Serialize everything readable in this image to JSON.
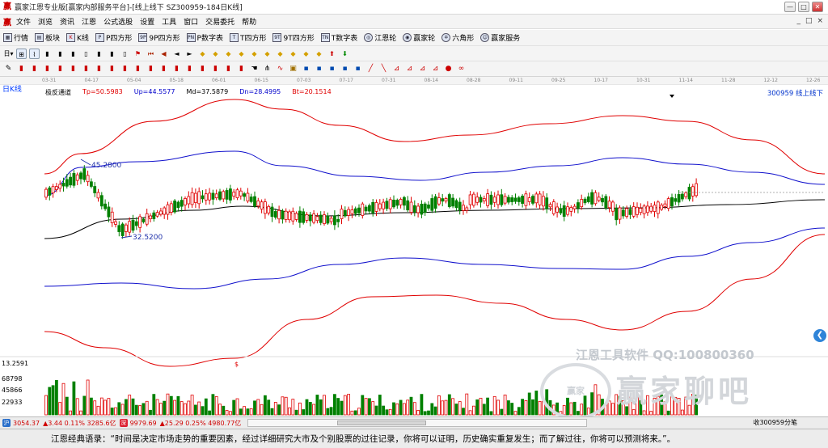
{
  "window": {
    "title": "赢家江恩专业版[赢家内部服务平台]-[线上线下 SZ300959-184日K线]",
    "controls": [
      "—",
      "□",
      "✕"
    ],
    "mdi_controls": [
      "_",
      "□",
      "×"
    ]
  },
  "menu": [
    "文件",
    "浏览",
    "资讯",
    "江恩",
    "公式选股",
    "设置",
    "工具",
    "窗口",
    "交易委托",
    "帮助"
  ],
  "toolbar1": [
    {
      "icon": "grid-icon",
      "label": "行情"
    },
    {
      "icon": "blocks-icon",
      "label": "板块"
    },
    {
      "icon": "kline-icon",
      "label": "K线"
    },
    {
      "icon": "p-square-icon",
      "label": "P四方形"
    },
    {
      "icon": "9p-square-icon",
      "label": "9P四方形"
    },
    {
      "icon": "p-number-icon",
      "label": "P数字表"
    },
    {
      "icon": "t-square-icon",
      "label": "T四方形"
    },
    {
      "icon": "9t-square-icon",
      "label": "9T四方形"
    },
    {
      "icon": "t-number-icon",
      "label": "T数字表"
    },
    {
      "icon": "gann-wheel-icon",
      "label": "江恩轮"
    },
    {
      "icon": "winner-wheel-icon",
      "label": "赢家轮"
    },
    {
      "icon": "hexagon-icon",
      "label": "六角形"
    },
    {
      "icon": "service-icon",
      "label": "赢家服务"
    }
  ],
  "chart": {
    "period_label": "日K线",
    "indicator_name": "极反通道",
    "indicators": [
      {
        "label": "Tp=50.5983",
        "color": "#e00000"
      },
      {
        "label": "Up=44.5577",
        "color": "#0000cc"
      },
      {
        "label": "Md=37.5879",
        "color": "#000000"
      },
      {
        "label": "Dn=28.4995",
        "color": "#0000cc"
      },
      {
        "label": "Bt=20.1514",
        "color": "#e00000"
      }
    ],
    "code_label": "300959  线上线下",
    "dates": [
      "03-31",
      "04-17",
      "05-04",
      "05-18",
      "06-01",
      "06-15",
      "07-03",
      "07-17",
      "07-31",
      "08-14",
      "08-28",
      "09-11",
      "09-25",
      "10-17",
      "10-31",
      "11-14",
      "11-28",
      "12-12",
      "12-26"
    ],
    "high_label": "45.2800",
    "low_label": "32.5200",
    "volume_axis": [
      "13.2591",
      "68798",
      "45866",
      "22933"
    ],
    "colors": {
      "top": "#e00000",
      "up": "#1010cc",
      "mid": "#000000",
      "dn": "#1010cc",
      "bottom": "#e00000",
      "rise": "#e00000",
      "fall": "#008000"
    }
  },
  "watermark": {
    "line1": "江恩工具软件  QQ:100800360",
    "brand": "赢家聊吧",
    "logo_text": "赢家"
  },
  "status": {
    "index1": "3054.37",
    "index1_change": "▲3.44 0.11% 3285.6亿",
    "index2": "9979.69",
    "index2_change": "▲25.29 0.25% 4980.77亿",
    "right_text": "收300959分笔"
  },
  "marquee": "江恩经典语录：“时间是决定市场走势的重要因素，经过详细研究大市及个别股票的过往记录，你将可以证明，历史确实重复发生；而了解过往，你将可以预测将来。”。"
}
